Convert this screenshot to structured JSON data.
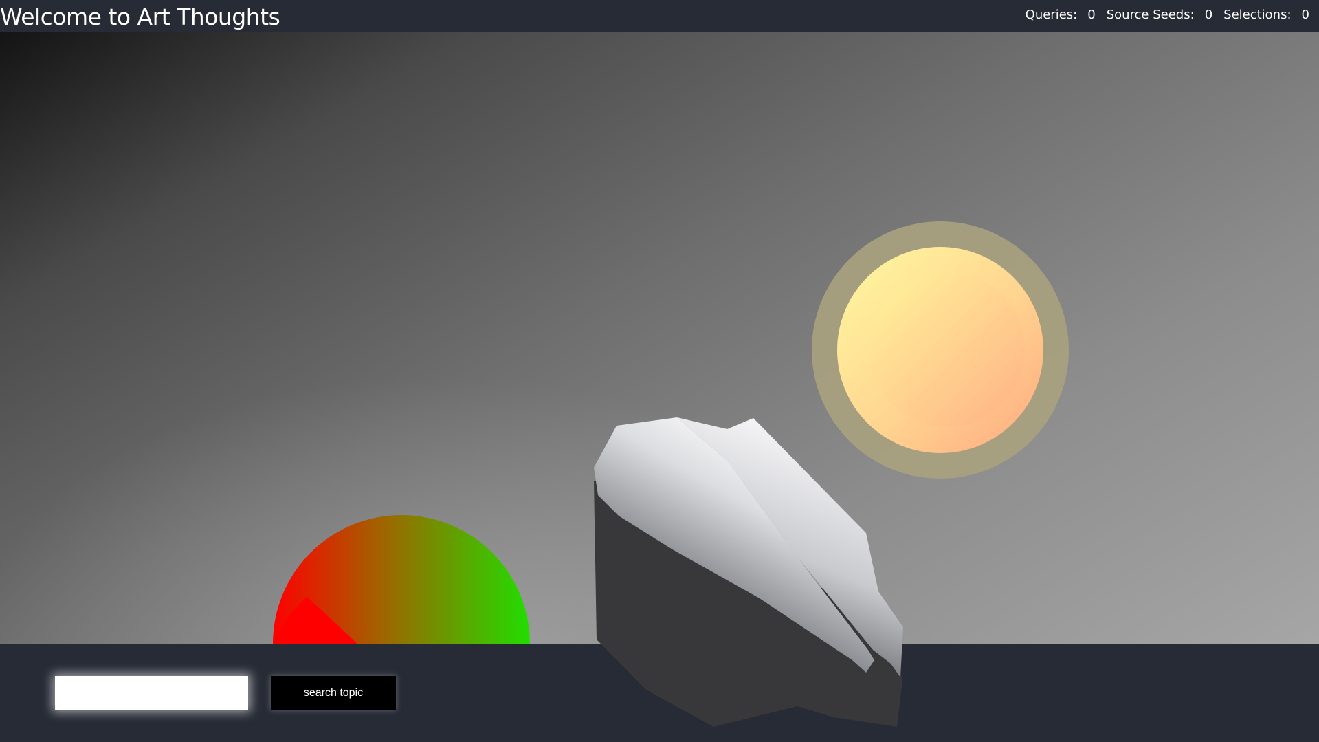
{
  "header": {
    "title": "Welcome to Art Thoughts",
    "stats": [
      {
        "label": "Queries:",
        "value": "0"
      },
      {
        "label": "Source Seeds:",
        "value": "0"
      },
      {
        "label": "Selections:",
        "value": "0"
      }
    ]
  },
  "search": {
    "value": "",
    "placeholder": "",
    "button_label": "search topic"
  },
  "colors": {
    "bar_background": "#272b35",
    "sun_outer": "#9a9a78",
    "sun_inner_light": "#fff7a0",
    "sun_inner_warm": "#ffb080",
    "dome_red": "#ff0000",
    "dome_green": "#22dd00",
    "rock_dark": "#3a3a3c",
    "rock_light": "#f2f2f2"
  }
}
